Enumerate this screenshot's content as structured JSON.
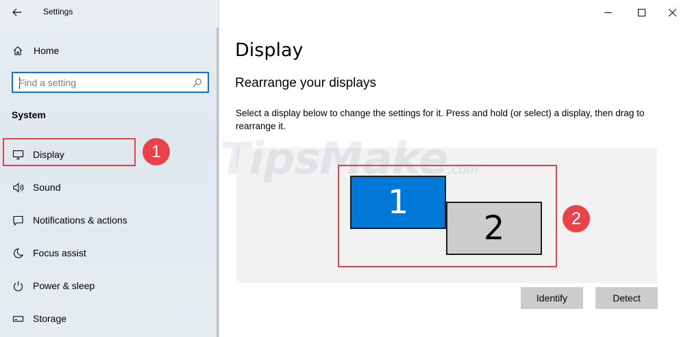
{
  "window": {
    "title": "Settings",
    "back_icon": "back-arrow-icon"
  },
  "sidebar": {
    "home_label": "Home",
    "search_placeholder": "Find a setting",
    "section_title": "System",
    "items": [
      {
        "label": "Display",
        "icon": "monitor-icon"
      },
      {
        "label": "Sound",
        "icon": "speaker-icon"
      },
      {
        "label": "Notifications & actions",
        "icon": "notification-icon"
      },
      {
        "label": "Focus assist",
        "icon": "moon-icon"
      },
      {
        "label": "Power & sleep",
        "icon": "power-icon"
      },
      {
        "label": "Storage",
        "icon": "storage-icon"
      }
    ]
  },
  "main": {
    "page_title": "Display",
    "subtitle": "Rearrange your displays",
    "description": "Select a display below to change the settings for it. Press and hold (or select) a display, then drag to rearrange it.",
    "monitors": [
      {
        "number": "1",
        "selected": true
      },
      {
        "number": "2",
        "selected": false
      }
    ],
    "identify_label": "Identify",
    "detect_label": "Detect"
  },
  "annotations": {
    "badge_1": "1",
    "badge_2": "2"
  },
  "watermark": {
    "text": "TipsMake",
    "suffix": ".com"
  },
  "colors": {
    "accent": "#0078d7",
    "annotation_red": "#e2404a",
    "button_gray": "#cccccc"
  }
}
